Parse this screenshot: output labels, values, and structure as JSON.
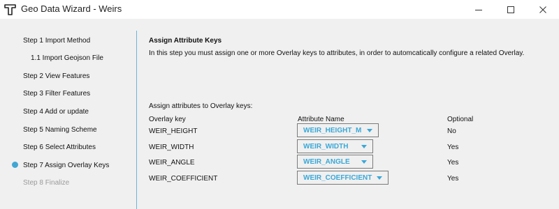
{
  "window": {
    "title": "Geo Data Wizard - Weirs"
  },
  "sidebar": {
    "items": [
      {
        "label": "Step 1 Import Method",
        "state": "normal"
      },
      {
        "label": "1.1 Import Geojson File",
        "state": "sub"
      },
      {
        "label": "Step 2 View Features",
        "state": "normal"
      },
      {
        "label": "Step 3 Filter Features",
        "state": "normal"
      },
      {
        "label": "Step 4 Add or update",
        "state": "normal"
      },
      {
        "label": "Step 5 Naming Scheme",
        "state": "normal"
      },
      {
        "label": "Step 6 Select Attributes",
        "state": "normal"
      },
      {
        "label": "Step 7 Assign Overlay Keys",
        "state": "active"
      },
      {
        "label": "Step 8 Finalize",
        "state": "disabled"
      }
    ],
    "active_color": "#41a6d4"
  },
  "main": {
    "heading": "Assign Attribute Keys",
    "description": "In this step you must assign one or more Overlay keys to attributes, in order to automcatically configure a related Overlay.",
    "assign_label": "Assign attributes to Overlay keys:",
    "columns": {
      "key": "Overlay key",
      "attribute": "Attribute Name",
      "optional": "Optional"
    },
    "rows": [
      {
        "key": "WEIR_HEIGHT",
        "attribute": "WEIR_HEIGHT_M",
        "optional": "No"
      },
      {
        "key": "WEIR_WIDTH",
        "attribute": "WEIR_WIDTH",
        "optional": "Yes"
      },
      {
        "key": "WEIR_ANGLE",
        "attribute": "WEIR_ANGLE",
        "optional": "Yes"
      },
      {
        "key": "WEIR_COEFFICIENT",
        "attribute": "WEIR_COEFFICIENT",
        "optional": "Yes"
      }
    ],
    "dropdown_text_color": "#3aa8d8"
  }
}
